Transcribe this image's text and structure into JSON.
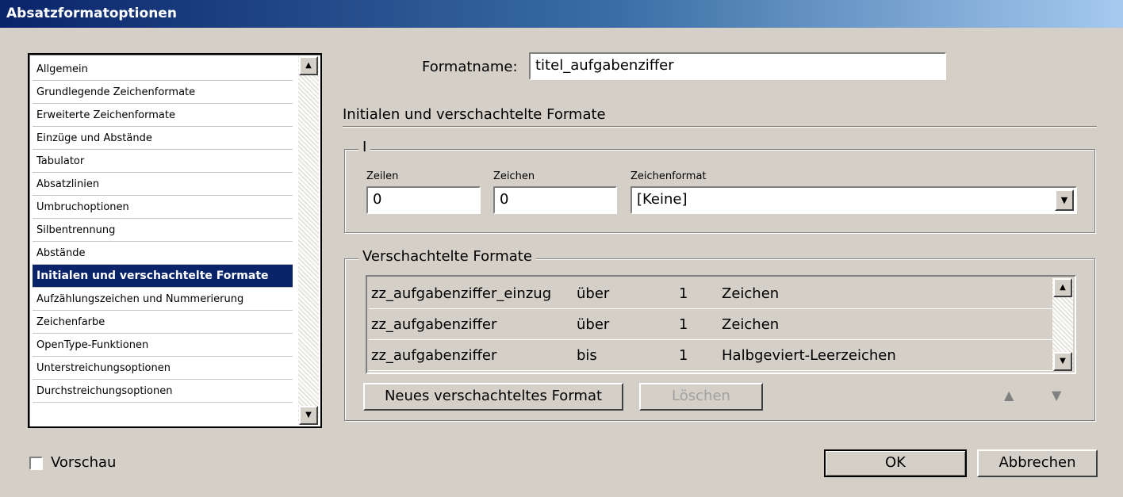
{
  "window": {
    "title": "Absatzformatoptionen"
  },
  "categories": [
    {
      "label": "Allgemein"
    },
    {
      "label": "Grundlegende Zeichenformate"
    },
    {
      "label": "Erweiterte Zeichenformate"
    },
    {
      "label": "Einzüge und Abstände"
    },
    {
      "label": "Tabulator"
    },
    {
      "label": "Absatzlinien"
    },
    {
      "label": "Umbruchoptionen"
    },
    {
      "label": "Silbentrennung"
    },
    {
      "label": "Abstände"
    },
    {
      "label": "Initialen und verschachtelte Formate",
      "selected": true
    },
    {
      "label": "Aufzählungszeichen und Nummerierung"
    },
    {
      "label": "Zeichenfarbe"
    },
    {
      "label": "OpenType-Funktionen"
    },
    {
      "label": "Unterstreichungsoptionen"
    },
    {
      "label": "Durchstreichungsoptionen"
    }
  ],
  "formatname": {
    "label": "Formatname:",
    "value": "titel_aufgabenziffer"
  },
  "section": {
    "title": "Initialen und verschachtelte Formate"
  },
  "initials": {
    "group_label": "I",
    "zeilen": {
      "label": "Zeilen",
      "value": "0"
    },
    "zeichen": {
      "label": "Zeichen",
      "value": "0"
    },
    "zeichenformat": {
      "label": "Zeichenformat",
      "value": "[Keine]"
    }
  },
  "nested": {
    "group_label": "Verschachtelte Formate",
    "rows": [
      {
        "format": "zz_aufgabenziffer_einzug",
        "mode": "über",
        "count": "1",
        "unit": "Zeichen"
      },
      {
        "format": "zz_aufgabenziffer",
        "mode": "über",
        "count": "1",
        "unit": "Zeichen"
      },
      {
        "format": "zz_aufgabenziffer",
        "mode": "bis",
        "count": "1",
        "unit": "Halbgeviert-Leerzeichen"
      }
    ],
    "new_button": "Neues verschachteltes Format",
    "delete_button": "Löschen"
  },
  "footer": {
    "preview_label": "Vorschau",
    "preview_checked": false,
    "ok": "OK",
    "cancel": "Abbrechen"
  },
  "colors": {
    "selection": "#0a246a",
    "dialog_bg": "#d4d0c8"
  },
  "icons": {
    "scroll_up": "▲",
    "scroll_down": "▼",
    "combo": "▼",
    "move_up": "▲",
    "move_down": "▼"
  }
}
